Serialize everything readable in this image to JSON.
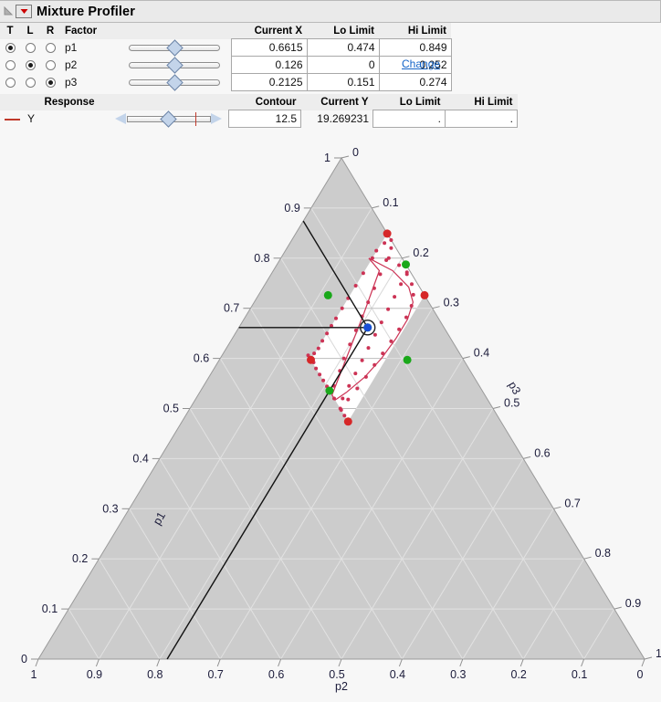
{
  "window": {
    "title": "Mixture Profiler",
    "disclosure_icon": "triangle-collapse-icon",
    "menu_icon": "red-down-arrow-icon"
  },
  "factor_table": {
    "headers": {
      "t": "T",
      "l": "L",
      "r": "R",
      "factor": "Factor",
      "current_x": "Current X",
      "lo_limit": "Lo Limit",
      "hi_limit": "Hi Limit"
    },
    "change_link": "Change",
    "rows": [
      {
        "name": "p1",
        "t": true,
        "l": false,
        "r": false,
        "current_x": "0.6615",
        "lo_limit": "0.474",
        "hi_limit": "0.849",
        "slider_pos": 0.5
      },
      {
        "name": "p2",
        "t": false,
        "l": true,
        "r": false,
        "current_x": "0.126",
        "lo_limit": "0",
        "hi_limit": "0.252",
        "slider_pos": 0.5
      },
      {
        "name": "p3",
        "t": false,
        "l": false,
        "r": true,
        "current_x": "0.2125",
        "lo_limit": "0.151",
        "hi_limit": "0.274",
        "slider_pos": 0.5
      }
    ]
  },
  "response_table": {
    "headers": {
      "response": "Response",
      "contour": "Contour",
      "current_y": "Current Y",
      "lo_limit": "Lo Limit",
      "hi_limit": "Hi Limit"
    },
    "rows": [
      {
        "name": "Y",
        "contour": "12.5",
        "current_y": "19.269231",
        "lo_limit": ".",
        "hi_limit": "."
      }
    ]
  },
  "chart_data": {
    "type": "scatter",
    "subtype": "ternary-mixture-contour-plot",
    "title": "",
    "axes": {
      "left": {
        "label": "p1",
        "ticks": [
          "0",
          "0.1",
          "0.2",
          "0.3",
          "0.4",
          "0.5",
          "0.6",
          "0.7",
          "0.8",
          "0.9",
          "1"
        ]
      },
      "bottom": {
        "label": "p2",
        "ticks": [
          "1",
          "0.9",
          "0.8",
          "0.7",
          "0.6",
          "0.5",
          "0.4",
          "0.3",
          "0.2",
          "0.1",
          "0"
        ]
      },
      "right": {
        "label": "p3",
        "ticks": [
          "0",
          "0.1",
          "0.2",
          "0.3",
          "0.4",
          "0.5",
          "0.6",
          "0.7",
          "0.8",
          "0.9",
          "1"
        ]
      }
    },
    "grid": true,
    "grid_step": 0.1,
    "outside_fill": "#cccccc",
    "feasible_fill": "#ffffff",
    "contour_color": "#cc3355",
    "contour_level": 12.5,
    "current_point": {
      "p1": 0.6615,
      "p2": 0.126,
      "p3": 0.2125,
      "color": "#1a4fd6"
    },
    "crosshair_color": "#111111",
    "feasible_region": {
      "comment": "parallelogram from factor lo/hi limits",
      "vertices": [
        {
          "p1": 0.849,
          "p2": 0.0,
          "p3": 0.151
        },
        {
          "p1": 0.726,
          "p2": 0.0,
          "p3": 0.274
        },
        {
          "p1": 0.474,
          "p2": 0.252,
          "p3": 0.274
        },
        {
          "p1": 0.597,
          "p2": 0.252,
          "p3": 0.151
        }
      ]
    },
    "limit_markers": [
      {
        "p1": 0.849,
        "p2": 0.0,
        "p3": 0.151,
        "color": "#d62728"
      },
      {
        "p1": 0.726,
        "p2": 0.0,
        "p3": 0.274,
        "color": "#d62728"
      },
      {
        "p1": 0.474,
        "p2": 0.252,
        "p3": 0.274,
        "color": "#d62728"
      },
      {
        "p1": 0.597,
        "p2": 0.252,
        "p3": 0.151,
        "color": "#d62728"
      },
      {
        "p1": 0.7875,
        "p2": 0.0,
        "p3": 0.2125,
        "color": "#1aa81a"
      },
      {
        "p1": 0.6615,
        "p2": 0.126,
        "p3": 0.2125,
        "color": "#1aa81a"
      },
      {
        "p1": 0.5355,
        "p2": 0.252,
        "p3": 0.2125,
        "color": "#1aa81a"
      },
      {
        "p1": 0.6615,
        "p2": 0.126,
        "p3": 0.274,
        "color": "#1aa81a"
      },
      {
        "p1": 0.6615,
        "p2": 0.126,
        "p3": 0.151,
        "color": "#1aa81a"
      }
    ],
    "contour_dots_count": 62
  }
}
